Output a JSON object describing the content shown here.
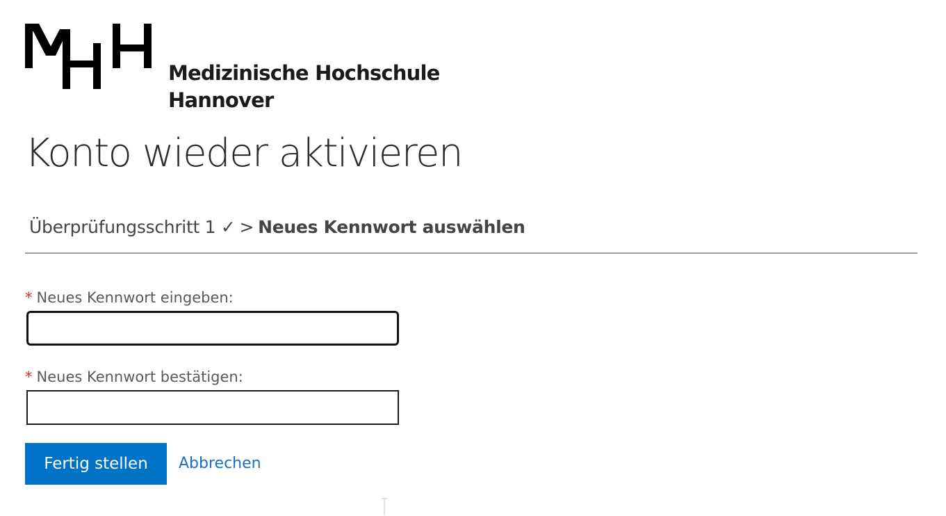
{
  "logo": {
    "line1": "Medizinische Hochschule",
    "line2": "Hannover",
    "icon": "mhh-logo-icon"
  },
  "page_title": "Konto wieder aktivieren",
  "breadcrumb": {
    "step1": "Überprüfungsschritt 1 ✓",
    "separator": ">",
    "current": "Neues Kennwort auswählen"
  },
  "form": {
    "required_marker": "*",
    "new_password_label": "Neues Kennwort eingeben:",
    "new_password_value": "",
    "confirm_password_label": "Neues Kennwort bestätigen:",
    "confirm_password_value": ""
  },
  "actions": {
    "submit_label": "Fertig stellen",
    "cancel_label": "Abbrechen"
  },
  "colors": {
    "primary_button": "#0073c6",
    "link": "#1a6fbf",
    "required": "#c0392b"
  }
}
